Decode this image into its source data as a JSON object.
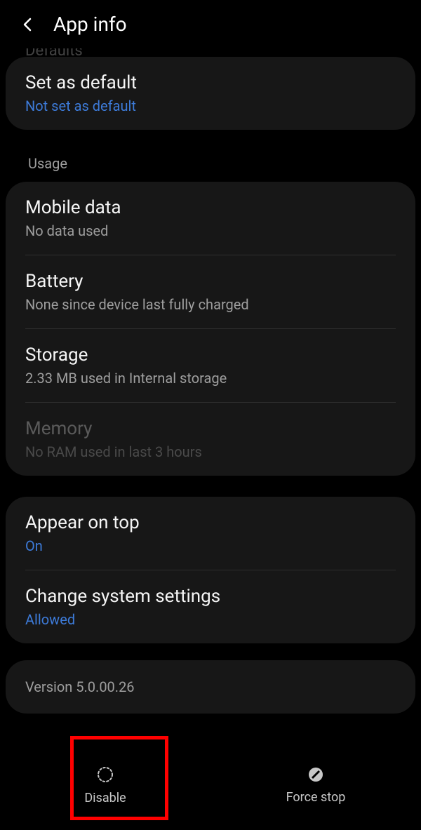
{
  "header": {
    "title": "App info"
  },
  "cutoff": "Defaults",
  "defaults": {
    "title": "Set as default",
    "sub": "Not set as default"
  },
  "usage": {
    "label": "Usage",
    "mobile_data": {
      "title": "Mobile data",
      "sub": "No data used"
    },
    "battery": {
      "title": "Battery",
      "sub": "None since device last fully charged"
    },
    "storage": {
      "title": "Storage",
      "sub": "2.33 MB used in Internal storage"
    },
    "memory": {
      "title": "Memory",
      "sub": "No RAM used in last 3 hours"
    }
  },
  "advanced": {
    "appear_on_top": {
      "title": "Appear on top",
      "sub": "On"
    },
    "change_system": {
      "title": "Change system settings",
      "sub": "Allowed"
    }
  },
  "version": "Version 5.0.00.26",
  "bottom": {
    "disable": "Disable",
    "force_stop": "Force stop"
  }
}
